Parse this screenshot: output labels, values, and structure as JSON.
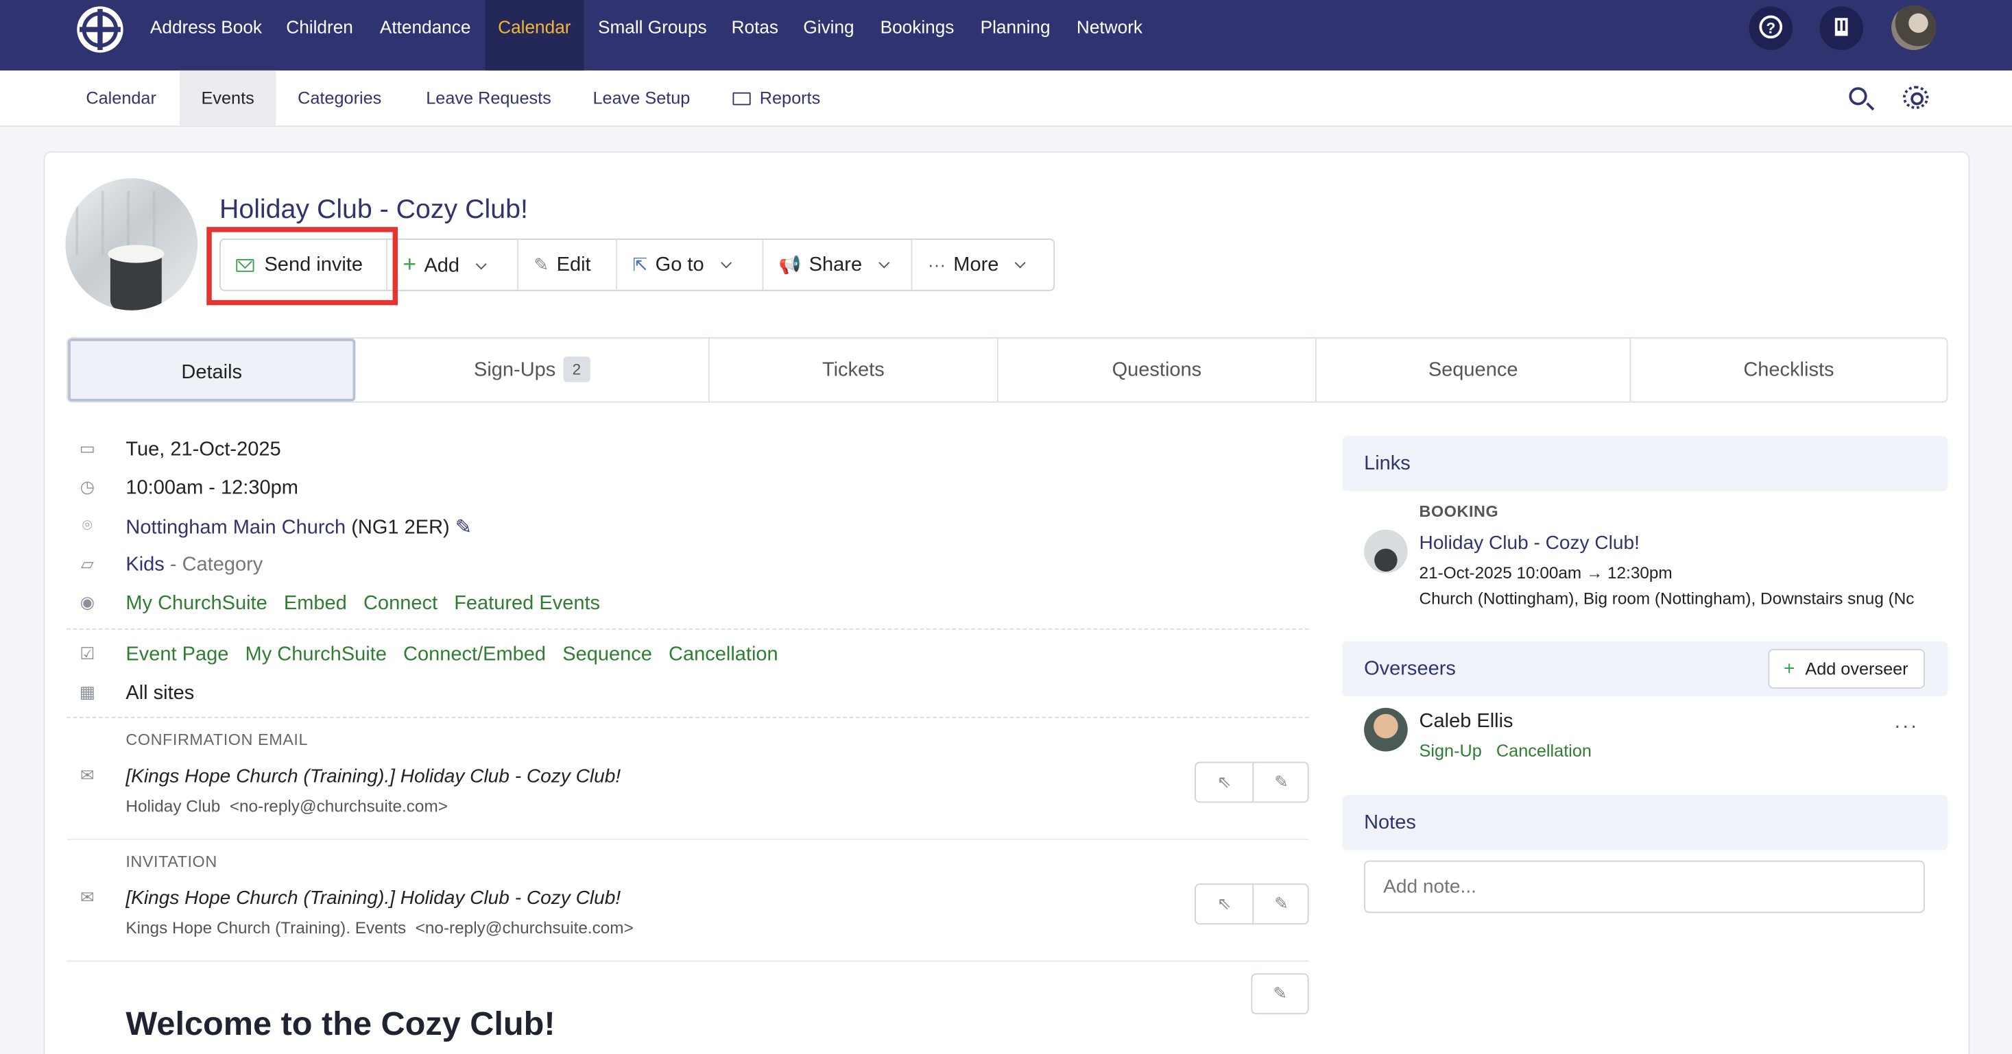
{
  "topnav": {
    "items": [
      "Address Book",
      "Children",
      "Attendance",
      "Calendar",
      "Small Groups",
      "Rotas",
      "Giving",
      "Bookings",
      "Planning",
      "Network"
    ],
    "active": "Calendar"
  },
  "subnav": {
    "items": [
      "Calendar",
      "Events",
      "Categories",
      "Leave Requests",
      "Leave Setup",
      "Reports"
    ],
    "active": "Events"
  },
  "event": {
    "title": "Holiday Club - Cozy Club!"
  },
  "actions": {
    "send_invite": "Send invite",
    "add": "Add",
    "edit": "Edit",
    "goto": "Go to",
    "share": "Share",
    "more": "More"
  },
  "tabs": {
    "details": "Details",
    "signups": "Sign-Ups",
    "signups_count": "2",
    "tickets": "Tickets",
    "questions": "Questions",
    "sequence": "Sequence",
    "checklists": "Checklists"
  },
  "details": {
    "date": "Tue, 21-Oct-2025",
    "time": "10:00am - 12:30pm",
    "location_name": "Nottingham Main Church",
    "location_postcode": "(NG1 2ER)",
    "category_name": "Kids",
    "category_suffix": "- Category",
    "visibility": [
      "My ChurchSuite",
      "Embed",
      "Connect",
      "Featured Events"
    ],
    "pages": [
      "Event Page",
      "My ChurchSuite",
      "Connect/Embed",
      "Sequence",
      "Cancellation"
    ],
    "sites": "All sites"
  },
  "emails": {
    "confirmation": {
      "caption": "CONFIRMATION EMAIL",
      "subject": "[Kings Hope Church (Training).] Holiday Club - Cozy Club!",
      "from_name": "Holiday Club",
      "from_email": "<no-reply@churchsuite.com>"
    },
    "invitation": {
      "caption": "INVITATION",
      "subject": "[Kings Hope Church (Training).] Holiday Club - Cozy Club!",
      "from_name": "Kings Hope Church (Training). Events",
      "from_email": "<no-reply@churchsuite.com>"
    }
  },
  "description": {
    "heading": "Welcome to the Cozy Club!"
  },
  "links": {
    "heading": "Links",
    "type": "BOOKING",
    "title": "Holiday Club - Cozy Club!",
    "when": "21-Oct-2025 10:00am → 12:30pm",
    "rooms": "Church (Nottingham), Big room (Nottingham), Downstairs snug (Nc"
  },
  "overseers": {
    "heading": "Overseers",
    "add_label": "Add overseer",
    "people": [
      {
        "name": "Caleb Ellis",
        "tags": [
          "Sign-Up",
          "Cancellation"
        ]
      }
    ]
  },
  "notes": {
    "heading": "Notes",
    "placeholder": "Add note..."
  },
  "colors": {
    "nav_bg": "#2f3470",
    "nav_active_text": "#f4b63a",
    "link": "#2f3470",
    "green": "#2e7d32",
    "highlight": "#e3342f"
  }
}
